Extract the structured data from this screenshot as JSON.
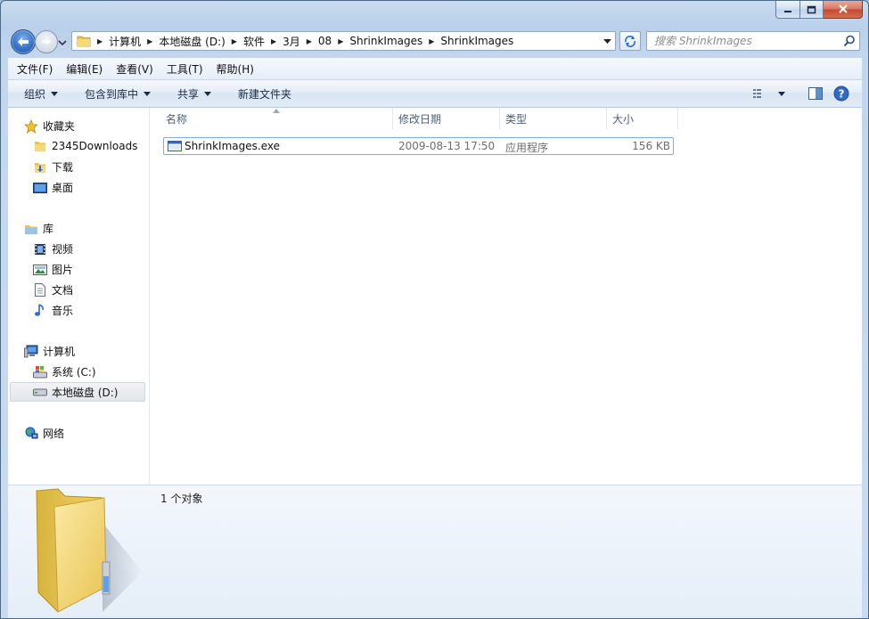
{
  "window": {
    "title": "ShrinkImages"
  },
  "address": {
    "path": [
      "计算机",
      "本地磁盘 (D:)",
      "软件",
      "3月",
      "08",
      "ShrinkImages",
      "ShrinkImages"
    ]
  },
  "search": {
    "placeholder": "搜索 ShrinkImages"
  },
  "menubar": {
    "items": [
      "文件(F)",
      "编辑(E)",
      "查看(V)",
      "工具(T)",
      "帮助(H)"
    ]
  },
  "commandbar": {
    "organize": "组织",
    "include_in_library": "包含到库中",
    "share": "共享",
    "new_folder": "新建文件夹"
  },
  "sidebar": {
    "favorites": {
      "label": "收藏夹",
      "items": [
        "2345Downloads",
        "下载",
        "桌面"
      ]
    },
    "libraries": {
      "label": "库",
      "items": [
        "视频",
        "图片",
        "文档",
        "音乐"
      ]
    },
    "computer": {
      "label": "计算机",
      "items": [
        "系统 (C:)",
        "本地磁盘 (D:)"
      ],
      "selected": "本地磁盘 (D:)"
    },
    "network": {
      "label": "网络"
    }
  },
  "filelist": {
    "columns": [
      "名称",
      "修改日期",
      "类型",
      "大小"
    ],
    "files": [
      {
        "name": "ShrinkImages.exe",
        "modified": "2009-08-13 17:50",
        "type": "应用程序",
        "size": "156 KB"
      }
    ]
  },
  "details": {
    "count_text": "1 个对象"
  },
  "colors": {
    "frame": "#c8dbf0",
    "selection_border": "#84acdd",
    "header_text": "#4c607a",
    "folder": "#f0d36a"
  },
  "icons": {
    "back": "back-arrow-icon",
    "forward": "forward-arrow-icon",
    "refresh": "refresh-icon",
    "search": "magnifier-icon",
    "view": "view-options-icon",
    "preview_pane": "preview-pane-icon",
    "help": "help-icon"
  }
}
